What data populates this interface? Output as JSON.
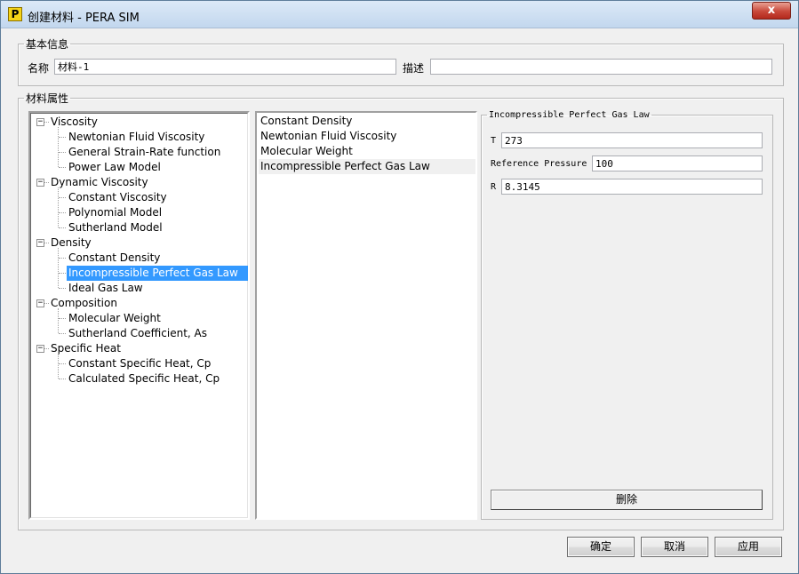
{
  "window": {
    "title": "创建材料 - PERA SIM",
    "app_icon_glyph": "P",
    "close_glyph": "x"
  },
  "basic_info": {
    "legend": "基本信息",
    "name_label": "名称",
    "name_value": "材料-1",
    "desc_label": "描述",
    "desc_value": ""
  },
  "material_props": {
    "legend": "材料属性"
  },
  "tree": {
    "expander_glyph": "−",
    "categories": [
      {
        "label": "Viscosity",
        "children": [
          "Newtonian Fluid Viscosity",
          "General Strain-Rate function",
          "Power Law Model"
        ]
      },
      {
        "label": "Dynamic Viscosity",
        "children": [
          "Constant Viscosity",
          "Polynomial Model",
          "Sutherland Model"
        ]
      },
      {
        "label": "Density",
        "children": [
          "Constant Density",
          "Incompressible Perfect Gas Law",
          "Ideal Gas Law"
        ]
      },
      {
        "label": "Composition",
        "children": [
          "Molecular Weight",
          "Sutherland Coefficient, As"
        ]
      },
      {
        "label": "Specific Heat",
        "children": [
          "Constant Specific Heat, Cp",
          "Calculated Specific Heat, Cp"
        ]
      }
    ],
    "selected": "Incompressible Perfect Gas Law"
  },
  "selected_list": {
    "items": [
      "Constant Density",
      "Newtonian Fluid Viscosity",
      "Molecular Weight",
      "Incompressible Perfect Gas Law"
    ],
    "highlighted": "Incompressible Perfect Gas Law"
  },
  "param_panel": {
    "legend": "Incompressible Perfect Gas Law",
    "fields": [
      {
        "label": "T",
        "value": "273"
      },
      {
        "label": "Reference Pressure",
        "value": "100"
      },
      {
        "label": "R",
        "value": "8.3145"
      }
    ],
    "delete_label": "删除"
  },
  "footer": {
    "ok_label": "确定",
    "cancel_label": "取消",
    "apply_label": "应用"
  }
}
